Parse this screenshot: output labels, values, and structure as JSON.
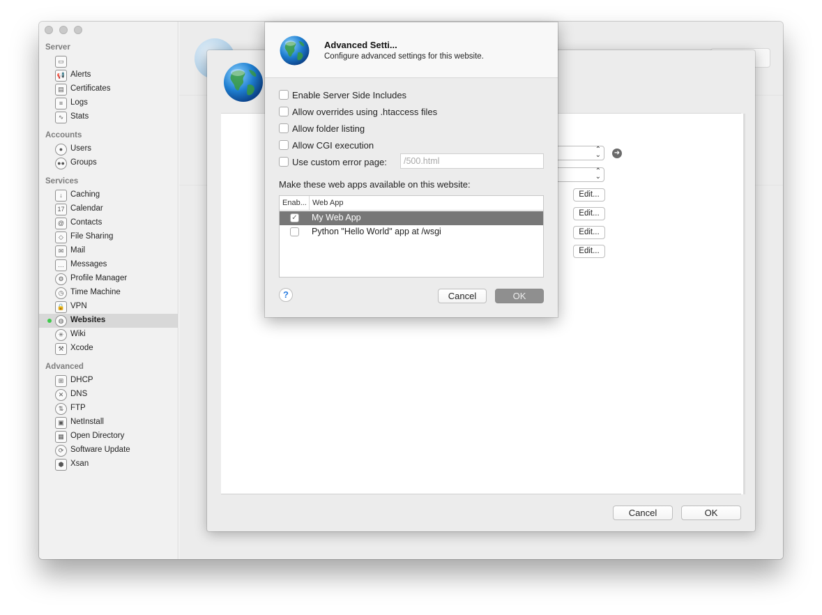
{
  "sidebar": {
    "sections": [
      {
        "header": "Server",
        "items": [
          {
            "label": "",
            "icon": "server-icon"
          },
          {
            "label": "Alerts",
            "icon": "megaphone-icon"
          },
          {
            "label": "Certificates",
            "icon": "certificate-icon"
          },
          {
            "label": "Logs",
            "icon": "log-icon"
          },
          {
            "label": "Stats",
            "icon": "stats-icon"
          }
        ]
      },
      {
        "header": "Accounts",
        "items": [
          {
            "label": "Users",
            "icon": "user-icon"
          },
          {
            "label": "Groups",
            "icon": "group-icon"
          }
        ]
      },
      {
        "header": "Services",
        "items": [
          {
            "label": "Caching",
            "icon": "caching-icon"
          },
          {
            "label": "Calendar",
            "icon": "calendar-icon"
          },
          {
            "label": "Contacts",
            "icon": "contacts-icon"
          },
          {
            "label": "File Sharing",
            "icon": "file-sharing-icon"
          },
          {
            "label": "Mail",
            "icon": "mail-icon"
          },
          {
            "label": "Messages",
            "icon": "messages-icon"
          },
          {
            "label": "Profile Manager",
            "icon": "profile-manager-icon"
          },
          {
            "label": "Time Machine",
            "icon": "time-machine-icon"
          },
          {
            "label": "VPN",
            "icon": "lock-icon"
          },
          {
            "label": "Websites",
            "icon": "globe-icon",
            "selected": true,
            "status_color": "#3ecb4b"
          },
          {
            "label": "Wiki",
            "icon": "wiki-icon"
          },
          {
            "label": "Xcode",
            "icon": "xcode-icon"
          }
        ]
      },
      {
        "header": "Advanced",
        "items": [
          {
            "label": "DHCP",
            "icon": "dhcp-icon"
          },
          {
            "label": "DNS",
            "icon": "dns-icon"
          },
          {
            "label": "FTP",
            "icon": "ftp-icon"
          },
          {
            "label": "NetInstall",
            "icon": "netinstall-icon"
          },
          {
            "label": "Open Directory",
            "icon": "open-directory-icon"
          },
          {
            "label": "Software Update",
            "icon": "software-update-icon"
          },
          {
            "label": "Xsan",
            "icon": "xsan-icon"
          }
        ]
      }
    ]
  },
  "site_sheet": {
    "edit_label": "Edit...",
    "cancel_label": "Cancel",
    "ok_label": "OK"
  },
  "dialog": {
    "title": "Advanced Setti...",
    "subtitle": "Configure advanced settings for this website.",
    "options": [
      {
        "label": "Enable Server Side Includes",
        "checked": false
      },
      {
        "label": "Allow overrides using .htaccess files",
        "checked": false
      },
      {
        "label": "Allow folder listing",
        "checked": false
      },
      {
        "label": "Allow CGI execution",
        "checked": false
      },
      {
        "label": "Use custom error page:",
        "checked": false
      }
    ],
    "error_page_placeholder": "/500.html",
    "webapps_label": "Make these web apps available on this website:",
    "table": {
      "columns": [
        "Enab...",
        "Web App"
      ],
      "rows": [
        {
          "enabled": true,
          "name": "My Web App",
          "selected": true
        },
        {
          "enabled": false,
          "name": "Python \"Hello World\" app at /wsgi",
          "selected": false
        }
      ]
    },
    "help_label": "?",
    "cancel_label": "Cancel",
    "ok_label": "OK"
  },
  "colors": {
    "selection": "#777777",
    "status_dot": "#3ecb4b",
    "help_blue": "#2b7de0"
  }
}
